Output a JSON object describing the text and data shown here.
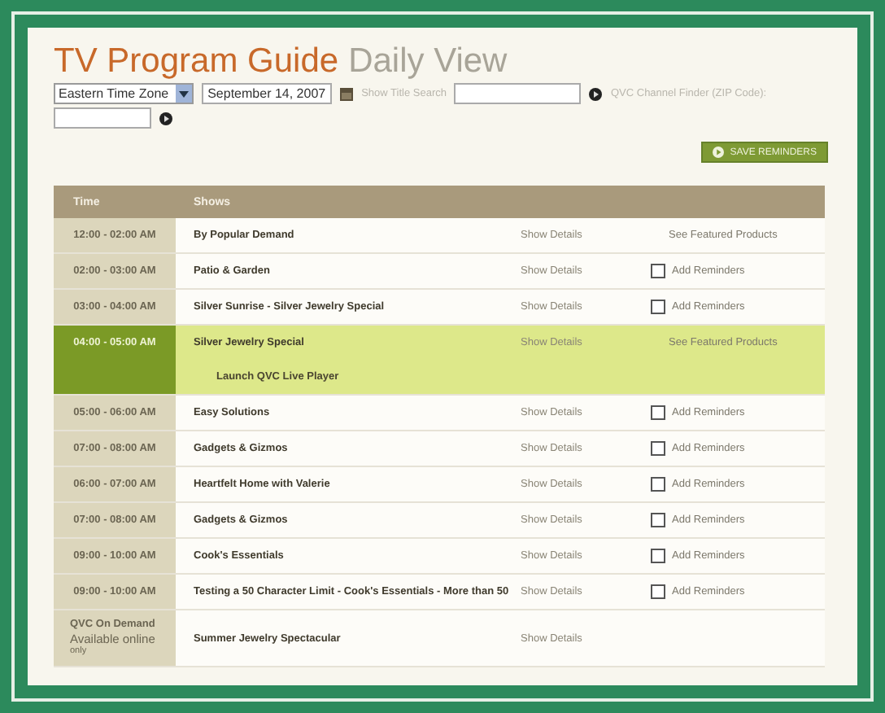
{
  "title": {
    "main": "TV Program Guide",
    "sub": "Daily View"
  },
  "filters": {
    "time_zone": "Eastern Time Zone",
    "date": "September 14, 2007",
    "title_search_label": "Show Title Search",
    "channel_finder_label": "QVC Channel Finder (ZIP Code):"
  },
  "save_button": "SAVE REMINDERS",
  "table": {
    "columns": [
      "Time",
      "Shows"
    ],
    "rows": [
      {
        "time": [
          "12:00 - 02:00 AM"
        ],
        "show": "By Popular Demand",
        "details": "Show Details",
        "kind": "featured",
        "action": "See Featured Products",
        "selected": false
      },
      {
        "time": [
          "02:00 - 03:00 AM"
        ],
        "show": "Patio & Garden",
        "details": "Show Details",
        "kind": "reminder",
        "action": "Add Reminders",
        "checked": false,
        "selected": false
      },
      {
        "time": [
          "03:00 - 04:00 AM"
        ],
        "show": "Silver Sunrise - Silver Jewelry Special",
        "details": "Show Details",
        "kind": "reminder",
        "action": "Add Reminders",
        "checked": false,
        "selected": false
      },
      {
        "time": [
          "04:00 - 05:00 AM"
        ],
        "show": "Silver Jewelry Special",
        "details": "Show Details",
        "kind": "featured",
        "action": "See Featured Products",
        "player_link": "Launch QVC Live Player",
        "selected": true
      },
      {
        "time": [
          "05:00 - 06:00 AM"
        ],
        "show": "Easy Solutions",
        "details": "Show Details",
        "kind": "reminder",
        "action": "Add Reminders",
        "checked": false,
        "selected": false
      },
      {
        "time": [
          "07:00 - 08:00 AM"
        ],
        "show": "Gadgets & Gizmos",
        "details": "Show Details",
        "kind": "reminder",
        "action": "Add Reminders",
        "checked": false,
        "selected": false
      },
      {
        "time": [
          "06:00 - 07:00 AM"
        ],
        "show": "Heartfelt Home with Valerie",
        "details": "Show Details",
        "kind": "reminder",
        "action": "Add Reminders",
        "checked": false,
        "selected": false
      },
      {
        "time": [
          "07:00 - 08:00 AM"
        ],
        "show": "Gadgets & Gizmos",
        "details": "Show Details",
        "kind": "reminder",
        "action": "Add Reminders",
        "checked": false,
        "selected": false
      },
      {
        "time": [
          "09:00 - 10:00 AM"
        ],
        "show": "Cook's Essentials",
        "details": "Show Details",
        "kind": "reminder",
        "action": "Add Reminders",
        "checked": false,
        "selected": false
      },
      {
        "time": [
          "09:00 - 10:00 AM"
        ],
        "show": "Testing a 50 Character Limit - Cook's Essentials - More than 50",
        "details": "Show Details",
        "kind": "reminder",
        "action": "Add Reminders",
        "checked": false,
        "selected": false
      },
      {
        "time": [
          "QVC On Demand",
          "Available online",
          "only"
        ],
        "show": "Summer Jewelry Spectacular",
        "details": "Show Details",
        "kind": "none",
        "selected": false
      }
    ]
  }
}
